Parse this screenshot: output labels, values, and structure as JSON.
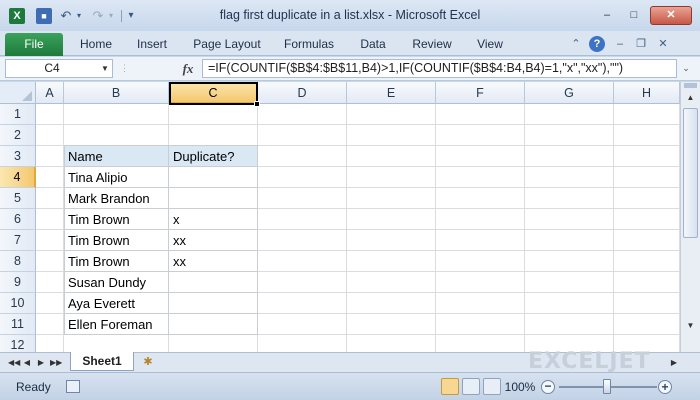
{
  "window": {
    "app_icon": "excel-icon",
    "title": "flag first duplicate in a list.xlsx - Microsoft Excel",
    "quick_access": {
      "save": "save-icon",
      "undo": "↶",
      "redo": "↷",
      "dropdown": "▾",
      "customize": "▾"
    },
    "controls": {
      "minimize": "‒",
      "maximize": "□",
      "close": "✕"
    }
  },
  "ribbon": {
    "file_label": "File",
    "tabs": [
      "Home",
      "Insert",
      "Page Layout",
      "Formulas",
      "Data",
      "Review",
      "View"
    ],
    "right_icons": {
      "minimize": "⌃",
      "help": "?",
      "doc_minimize": "‒",
      "doc_restore": "❐",
      "doc_close": "✕"
    }
  },
  "formula_bar": {
    "name_box": "C4",
    "name_box_arrow": "▼",
    "fx_label": "fx",
    "formula": "=IF(COUNTIF($B$4:$B$11,B4)>1,IF(COUNTIF($B$4:B4,B4)=1,\"x\",\"xx\"),\"\")",
    "expand": "⌄"
  },
  "sheet": {
    "columns": [
      "A",
      "B",
      "C",
      "D",
      "E",
      "F",
      "G",
      "H"
    ],
    "selected_column": "C",
    "rows": [
      "1",
      "2",
      "3",
      "4",
      "5",
      "6",
      "7",
      "8",
      "9",
      "10",
      "11",
      "12"
    ],
    "selected_row": "4",
    "table": {
      "header": [
        "Name",
        "Duplicate?"
      ],
      "rows": [
        [
          "Tina Alipio",
          ""
        ],
        [
          "Mark Brandon",
          ""
        ],
        [
          "Tim Brown",
          "x"
        ],
        [
          "Tim Brown",
          "xx"
        ],
        [
          "Tim Brown",
          "xx"
        ],
        [
          "Susan Dundy",
          ""
        ],
        [
          "Aya Everett",
          ""
        ],
        [
          "Ellen Foreman",
          ""
        ]
      ]
    },
    "header_fill": "#d9e8f3",
    "active_cell": "C4"
  },
  "scrollbars": {
    "up": "▲",
    "down": "▼",
    "right": "▶"
  },
  "sheet_tabs": {
    "nav": [
      "◀◀",
      "◀",
      "▶",
      "▶▶"
    ],
    "active_tab": "Sheet1",
    "new_sheet_icon": "✱",
    "watermark": "EXCELJET"
  },
  "status_bar": {
    "status": "Ready",
    "zoom": "100%",
    "zoom_out": "−",
    "zoom_in": "+",
    "zoom_fraction": 0.5
  }
}
